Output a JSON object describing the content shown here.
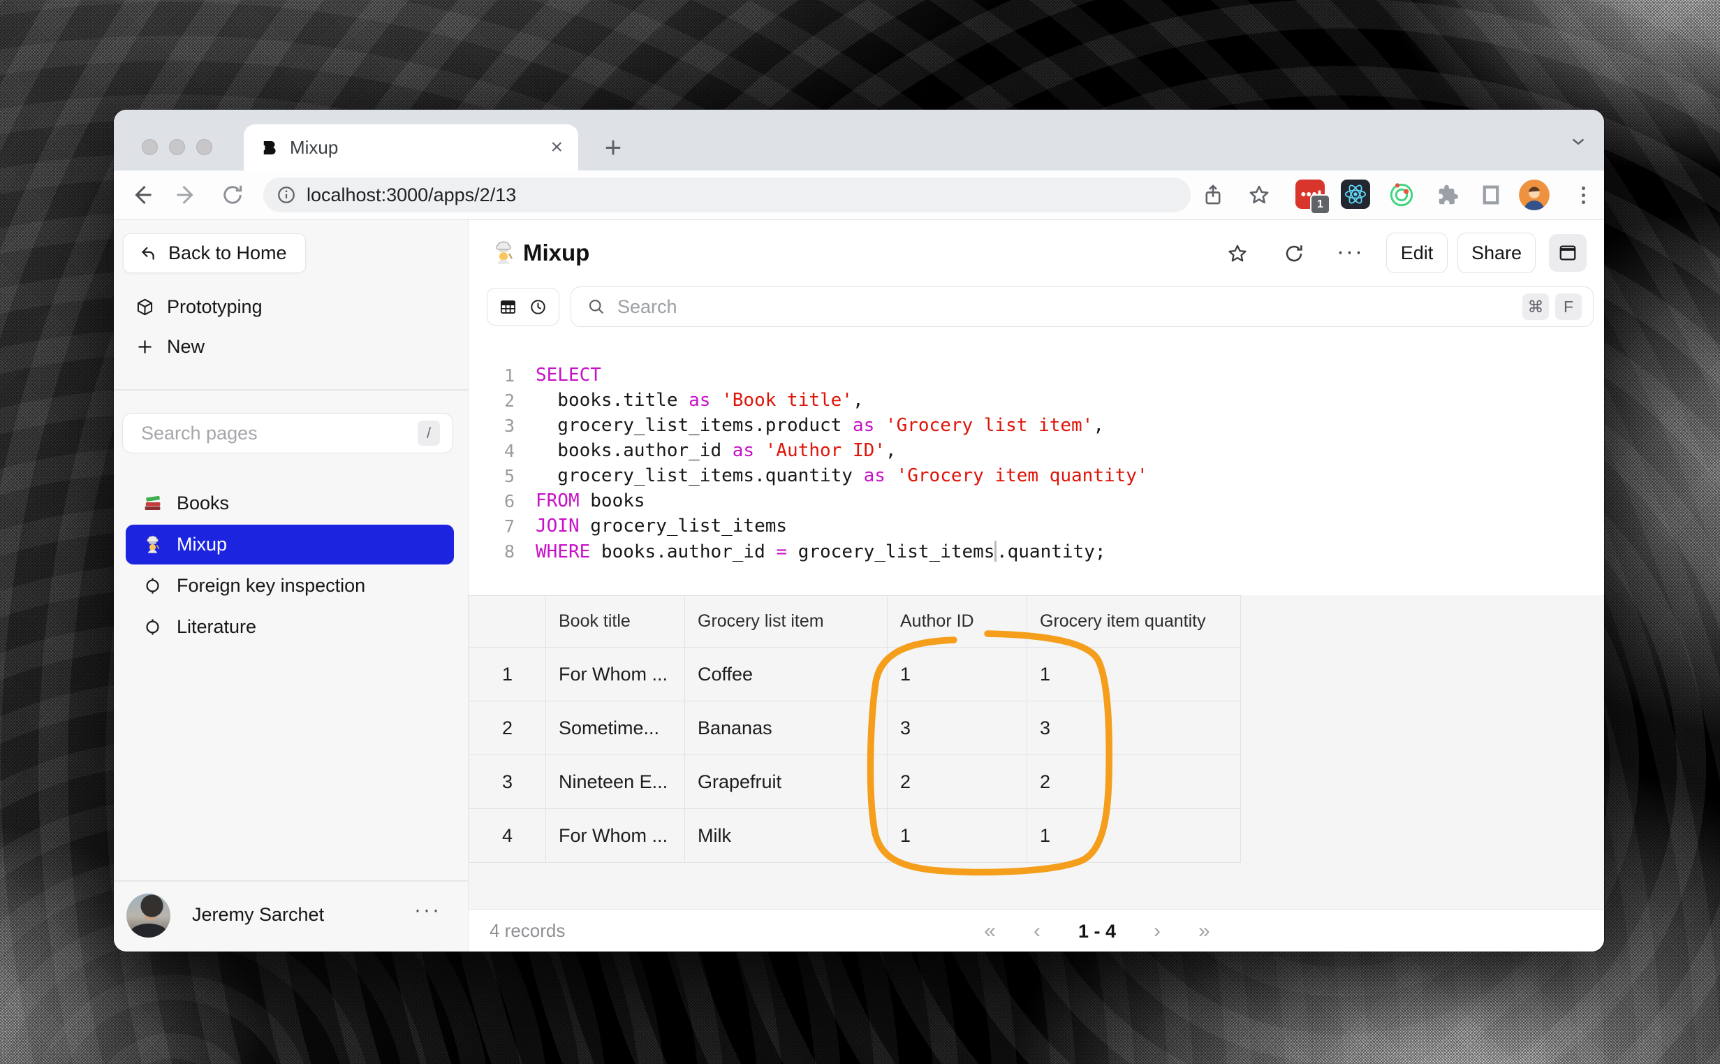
{
  "browser": {
    "tab_title": "Mixup",
    "tab_close_glyph": "×",
    "new_tab_glyph": "+",
    "strip_chevron_glyph": "⌄",
    "url": "localhost:3000/apps/2/13",
    "extension_badge_count": "1"
  },
  "sidebar": {
    "back_button_label": "Back to Home",
    "nav": {
      "prototyping_label": "Prototyping",
      "new_label": "New"
    },
    "search": {
      "placeholder": "Search pages",
      "shortcut": "/"
    },
    "pages": [
      {
        "label": "Books",
        "icon": "books-icon",
        "selected": false
      },
      {
        "label": "Mixup",
        "icon": "chef-icon",
        "selected": true
      },
      {
        "label": "Foreign key inspection",
        "icon": "page-icon",
        "selected": false
      },
      {
        "label": "Literature",
        "icon": "page-icon",
        "selected": false
      }
    ],
    "user": {
      "name": "Jeremy Sarchet",
      "menu_glyph": "···"
    }
  },
  "header": {
    "title": "Mixup",
    "more_glyph": "···",
    "edit_label": "Edit",
    "share_label": "Share"
  },
  "toolbar": {
    "search_placeholder": "Search",
    "shortcut_keys": [
      "⌘",
      "F"
    ]
  },
  "sql": {
    "lines": [
      {
        "n": "1",
        "segs": [
          {
            "k": "kw",
            "t": "SELECT"
          }
        ]
      },
      {
        "n": "2",
        "segs": [
          {
            "k": "id",
            "t": "  books.title "
          },
          {
            "k": "kw",
            "t": "as"
          },
          {
            "k": "id",
            "t": " "
          },
          {
            "k": "str",
            "t": "'Book title'"
          },
          {
            "k": "id",
            "t": ","
          }
        ]
      },
      {
        "n": "3",
        "segs": [
          {
            "k": "id",
            "t": "  grocery_list_items.product "
          },
          {
            "k": "kw",
            "t": "as"
          },
          {
            "k": "id",
            "t": " "
          },
          {
            "k": "str",
            "t": "'Grocery list item'"
          },
          {
            "k": "id",
            "t": ","
          }
        ]
      },
      {
        "n": "4",
        "segs": [
          {
            "k": "id",
            "t": "  books.author_id "
          },
          {
            "k": "kw",
            "t": "as"
          },
          {
            "k": "id",
            "t": " "
          },
          {
            "k": "str",
            "t": "'Author ID'"
          },
          {
            "k": "id",
            "t": ","
          }
        ]
      },
      {
        "n": "5",
        "segs": [
          {
            "k": "id",
            "t": "  grocery_list_items.quantity "
          },
          {
            "k": "kw",
            "t": "as"
          },
          {
            "k": "id",
            "t": " "
          },
          {
            "k": "str",
            "t": "'Grocery item quantity'"
          }
        ]
      },
      {
        "n": "6",
        "segs": [
          {
            "k": "kw",
            "t": "FROM"
          },
          {
            "k": "id",
            "t": " books"
          }
        ]
      },
      {
        "n": "7",
        "segs": [
          {
            "k": "kw",
            "t": "JOIN"
          },
          {
            "k": "id",
            "t": " grocery_list_items"
          }
        ]
      },
      {
        "n": "8",
        "segs": [
          {
            "k": "kw",
            "t": "WHERE"
          },
          {
            "k": "id",
            "t": " books.author_id "
          },
          {
            "k": "kw",
            "t": "="
          },
          {
            "k": "id",
            "t": " grocery_list_items"
          },
          {
            "k": "cursor",
            "t": ""
          },
          {
            "k": "id",
            "t": ".quantity;"
          }
        ]
      }
    ]
  },
  "results": {
    "columns": [
      "Book title",
      "Grocery list item",
      "Author ID",
      "Grocery item quantity"
    ],
    "rows": [
      {
        "num": "1",
        "cells": [
          "For Whom ...",
          "Coffee",
          "1",
          "1"
        ]
      },
      {
        "num": "2",
        "cells": [
          "Sometime...",
          "Bananas",
          "3",
          "3"
        ]
      },
      {
        "num": "3",
        "cells": [
          "Nineteen E...",
          "Grapefruit",
          "2",
          "2"
        ]
      },
      {
        "num": "4",
        "cells": [
          "For Whom ...",
          "Milk",
          "1",
          "1"
        ]
      }
    ],
    "footer": {
      "records": "4 records",
      "page_range": "1 - 4",
      "first_glyph": "«",
      "prev_glyph": "‹",
      "next_glyph": "›",
      "last_glyph": "»"
    }
  },
  "colors": {
    "accent_blue": "#1c24e0",
    "annotation_orange": "#f49e1c",
    "sql_keyword": "#c711c7",
    "sql_string": "#de1408"
  }
}
